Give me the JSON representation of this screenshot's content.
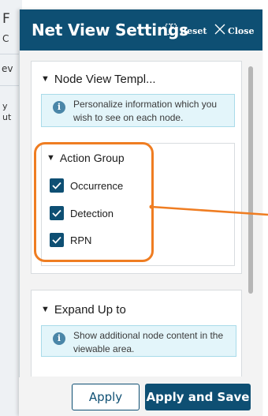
{
  "background_app": {
    "fragments": [
      "F",
      "C",
      "ev",
      "y",
      "ut"
    ]
  },
  "panel": {
    "title": "Net View Settings",
    "reset_label": "Reset",
    "close_label": "Close"
  },
  "sections": [
    {
      "title": "Node View Templ...",
      "expanded": true,
      "info_text": "Personalize information which you wish to see on each node.",
      "action_group": {
        "title": "Action Group",
        "items": [
          {
            "label": "Occurrence",
            "checked": true
          },
          {
            "label": "Detection",
            "checked": true
          },
          {
            "label": "RPN",
            "checked": true
          }
        ]
      }
    },
    {
      "title": "Expand Up to",
      "expanded": true,
      "info_text": "Show additional node content in the viewable area."
    }
  ],
  "footer": {
    "apply_label": "Apply",
    "apply_save_label": "Apply and Save"
  },
  "colors": {
    "header": "#0e4f73",
    "highlight": "#ef7d22",
    "info_bg": "#e3f5fa"
  }
}
